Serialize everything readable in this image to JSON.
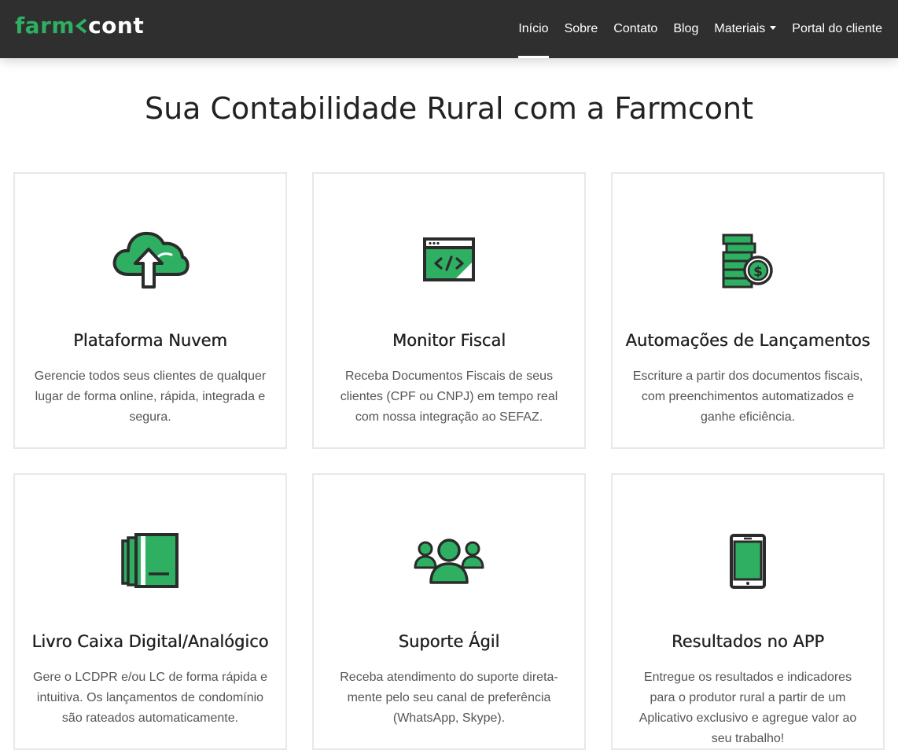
{
  "brand": {
    "part1": "farm",
    "part2": "cont",
    "accent_color": "#2eaf62"
  },
  "nav": {
    "items": [
      {
        "label": "Início",
        "active": true
      },
      {
        "label": "Sobre"
      },
      {
        "label": "Contato"
      },
      {
        "label": "Blog"
      },
      {
        "label": "Materiais",
        "dropdown": true
      },
      {
        "label": "Portal do cliente"
      }
    ]
  },
  "page": {
    "title": "Sua Contabilidade Rural com a Farmcont"
  },
  "cards": [
    {
      "icon": "cloud-upload-icon",
      "title": "Plataforma Nuvem",
      "text": "Gerencie todos seus clientes de qualquer lugar de forma online, rápida, integrada e segura."
    },
    {
      "icon": "browser-code-icon",
      "title": "Monitor Fiscal",
      "text": "Receba Documentos Fiscais de seus clientes (CPF ou CNPJ) em tempo real com nossa integração ao SEFAZ."
    },
    {
      "icon": "coins-dollar-icon",
      "title": "Automações de Lançamentos",
      "text": "Escriture a partir dos documentos fiscais, com preenchimentos automatizados e ganhe eficiência."
    },
    {
      "icon": "ledger-book-icon",
      "title": "Livro Caixa Digital/Analógico",
      "text": "Gere o LCDPR e/ou LC de forma rápida e intuitiva. Os lançamentos de condomínio são rateados automaticamente."
    },
    {
      "icon": "users-group-icon",
      "title": "Suporte Ágil",
      "text": "Receba atendimento do suporte direta-mente pelo seu canal de preferência (WhatsApp, Skype)."
    },
    {
      "icon": "smartphone-icon",
      "title": "Resultados no APP",
      "text": "Entregue os resultados e indicadores para o produtor rural a partir de um Aplicativo exclusivo e agregue valor ao seu trabalho!"
    }
  ]
}
